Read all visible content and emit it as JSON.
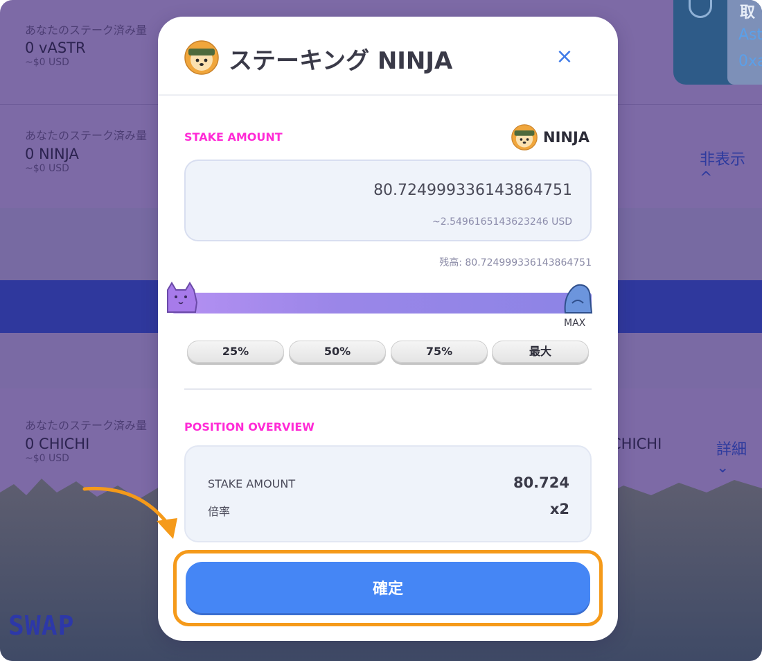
{
  "background": {
    "rows": [
      {
        "label": "あなたのステーク済み量",
        "amount": "0 vASTR",
        "usd": "~$0 USD"
      },
      {
        "label": "あなたのステーク済み量",
        "amount": "0 NINJA",
        "usd": "~$0 USD",
        "toggle": "非表示 ^"
      },
      {
        "label": "あなたのステーク済み量",
        "amount": "0 CHICHI",
        "usd": "~$0 USD",
        "right_text": "CHICHI",
        "toggle": "詳細 ⌄"
      }
    ],
    "card": {
      "title": "取",
      "line1": "Ast",
      "line2": "0xa"
    },
    "swap_text": "SWAP"
  },
  "modal": {
    "title": "ステーキング NINJA",
    "close_icon": "×",
    "stake_label": "STAKE AMOUNT",
    "token_symbol": "NINJA",
    "amount_value": "80.724999336143864751",
    "amount_usd": "~2.5496165143623246 USD",
    "balance": "残高: 80.724999336143864751",
    "slider": {
      "max_label": "MAX",
      "fraction": 1.0
    },
    "percent_buttons": [
      "25%",
      "50%",
      "75%",
      "最大"
    ],
    "overview_label": "POSITION OVERVIEW",
    "overview": [
      {
        "label": "STAKE AMOUNT",
        "value": "80.724"
      },
      {
        "label": "倍率",
        "value": "x2"
      }
    ],
    "confirm_label": "確定"
  },
  "colors": {
    "accent": "#4586f5",
    "highlight": "#f59a1a",
    "section_label": "#ff2bd6"
  }
}
